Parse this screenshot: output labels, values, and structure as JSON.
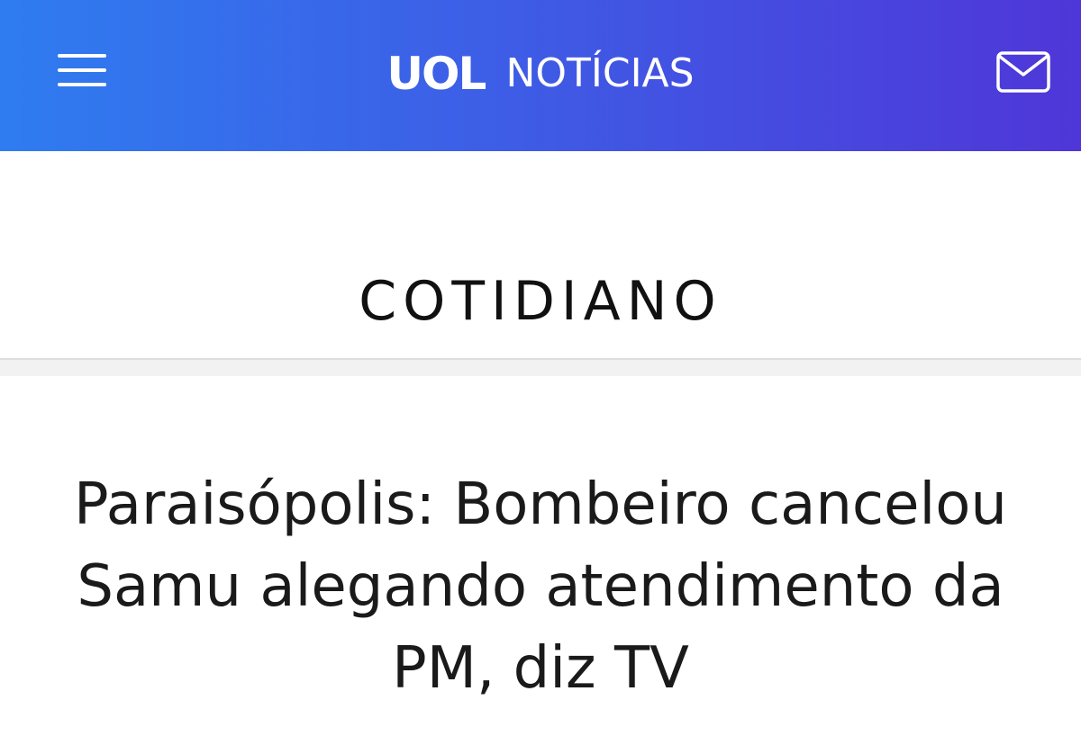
{
  "header": {
    "menu_icon": "hamburger-menu-icon",
    "logo_text": "UOL",
    "section_name": "NOTÍCIAS",
    "mail_icon": "envelope-icon",
    "colors": {
      "gradient_start": "#2f7cf0",
      "gradient_end": "#4f36d8",
      "foreground": "#ffffff"
    }
  },
  "section": {
    "title": "COTIDIANO"
  },
  "article": {
    "headline": "Paraisópolis: Bombeiro cancelou Samu alegando atendimento da PM, diz TV"
  }
}
